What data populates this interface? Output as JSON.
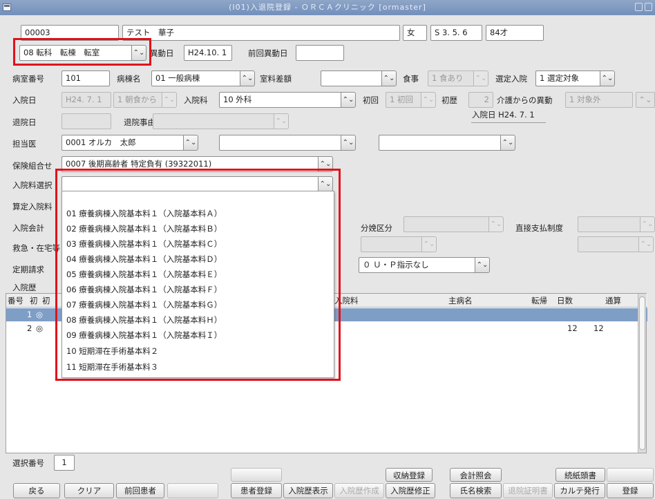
{
  "window": {
    "title": "(I01)入退院登録 - ＯＲＣＡクリニック  [ormaster]"
  },
  "patient": {
    "id": "00003",
    "name": "テスト　華子",
    "sex": "女",
    "birth": "S 3. 5. 6",
    "age": "84才"
  },
  "transfer": {
    "value": "08 転科　転棟　転室",
    "date_label": "異動日",
    "date": "H24.10. 1",
    "prev_label": "前回異動日",
    "prev": ""
  },
  "row1": {
    "room_label": "病室番号",
    "room": "101",
    "ward_label": "病棟名",
    "ward": "01 一般病棟",
    "room_fee_label": "室料差額",
    "room_fee": "",
    "meal_label": "食事",
    "meal": "1 食あり",
    "select_label": "選定入院",
    "select": "1 選定対象"
  },
  "row2": {
    "admit_label": "入院日",
    "admit_date": "H24. 7. 1",
    "meal_from": "1 朝食から",
    "dept_label": "入院科",
    "dept": "10 外科",
    "first_label": "初回",
    "first": "1 初回",
    "count_label": "初歴",
    "count": "2",
    "care_label": "介護からの異動",
    "care": "1 対象外",
    "admit_info": "入院日 H24. 7. 1"
  },
  "row3": {
    "discharge_label": "退院日",
    "discharge_date": "",
    "reason_label": "退院事由",
    "reason": ""
  },
  "row4": {
    "doctor_label": "担当医",
    "doctor1": "0001 オルカ　太郎",
    "doctor2": "",
    "doctor3": ""
  },
  "row5": {
    "insurance_label": "保険組合せ",
    "insurance": "0007 後期高齢者 特定負有 (39322011)"
  },
  "row6": {
    "fee_label": "入院料選択",
    "fee": ""
  },
  "labels": {
    "calc_fee": "算定入院料",
    "admit_account": "入院会計",
    "emergency": "救急・在宅等",
    "regular_bill": "定期請求",
    "history": "入院歴",
    "delivery": "分娩区分",
    "direct_pay": "直接支払制度",
    "up_instruction": "０ Ｕ・Ｐ指示なし"
  },
  "dropdown": {
    "items": [
      "01 療養病棟入院基本料１（入院基本料Ａ）",
      "02 療養病棟入院基本料１（入院基本料Ｂ）",
      "03 療養病棟入院基本料１（入院基本料Ｃ）",
      "04 療養病棟入院基本料１（入院基本料Ｄ）",
      "05 療養病棟入院基本料１（入院基本料Ｅ）",
      "06 療養病棟入院基本料１（入院基本料Ｆ）",
      "07 療養病棟入院基本料１（入院基本料Ｇ）",
      "08 療養病棟入院基本料１（入院基本料Ｈ）",
      "09 療養病棟入院基本料１（入院基本料Ｉ）",
      "10 短期滞在手術基本料２",
      "11 短期滞在手術基本料３"
    ]
  },
  "history": {
    "columns": {
      "no": "番号",
      "first": "初",
      "first2": "初",
      "fee": "入院料",
      "disease": "主病名",
      "outcome": "転帰",
      "days": "日数",
      "total": "通算"
    },
    "rows": [
      {
        "no": "1",
        "mark": "◎",
        "days": "",
        "total": ""
      },
      {
        "no": "2",
        "mark": "◎",
        "days": "12",
        "total": "12"
      }
    ]
  },
  "footer": {
    "select_label": "選択番号",
    "select_value": "1",
    "top_buttons": {
      "receipt": "収納登録",
      "account": "会計照会",
      "header": "続紙頭書"
    },
    "buttons": {
      "back": "戻る",
      "clear": "クリア",
      "prev_patient": "前回患者",
      "patient_reg": "患者登録",
      "history_show": "入院歴表示",
      "history_make": "入院歴作成",
      "history_fix": "入院歴修正",
      "name_search": "氏名検索",
      "discharge_cert": "退院証明書",
      "chart": "カルテ発行",
      "register": "登録"
    }
  }
}
